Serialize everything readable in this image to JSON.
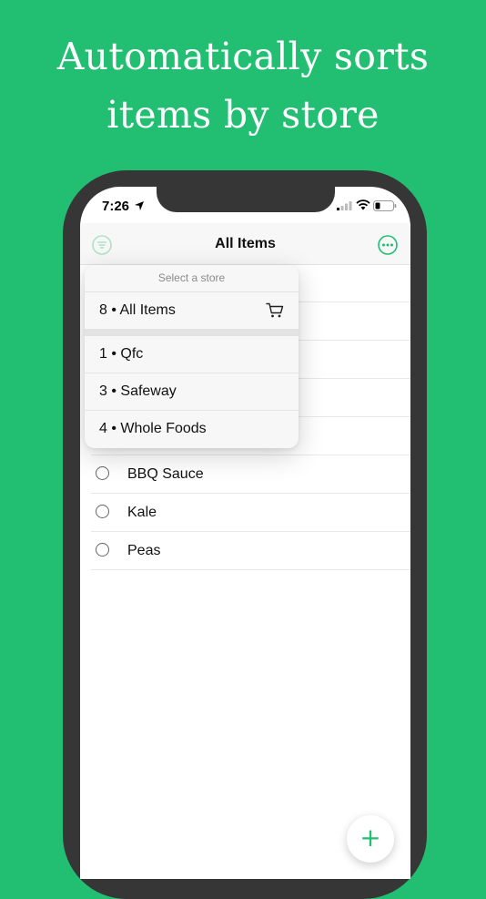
{
  "headline": {
    "line1": "Automatically sorts",
    "line2": "items by store"
  },
  "status_bar": {
    "time": "7:26"
  },
  "navbar": {
    "title": "All Items",
    "left_icon": "filter-icon",
    "right_icon": "more-icon"
  },
  "list": {
    "items": [
      {
        "label": ""
      },
      {
        "label": ""
      },
      {
        "label": ""
      },
      {
        "label": ""
      },
      {
        "label": ""
      },
      {
        "label": "BBQ Sauce"
      },
      {
        "label": "Kale"
      },
      {
        "label": "Peas"
      }
    ]
  },
  "dropdown": {
    "header": "Select a store",
    "all_items": "8 • All Items",
    "stores": [
      {
        "label": "1 • Qfc"
      },
      {
        "label": "3 • Safeway"
      },
      {
        "label": "4 • Whole Foods"
      }
    ]
  },
  "fab": {
    "label": "+"
  },
  "colors": {
    "brand_green": "#22bf72",
    "phone_frame": "#363636"
  }
}
